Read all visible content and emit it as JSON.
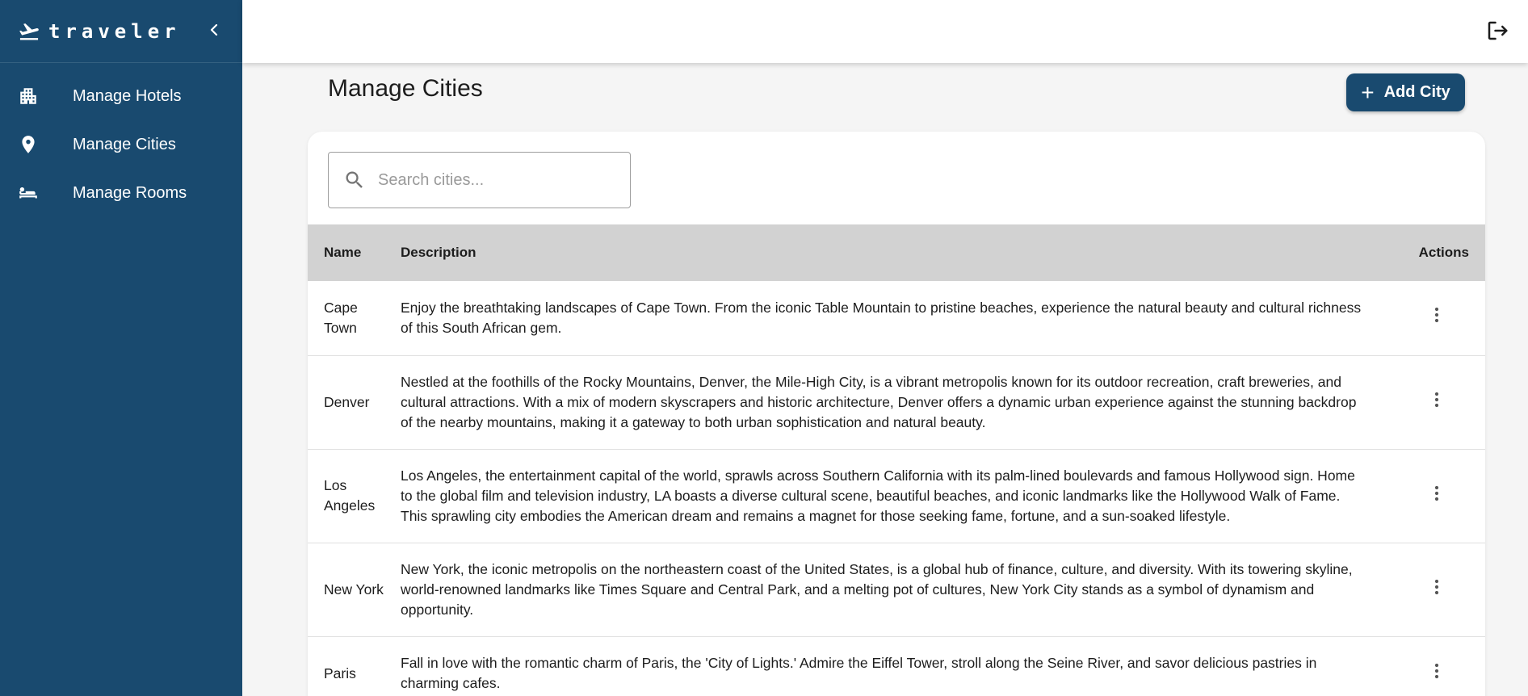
{
  "app": {
    "brand": "traveler"
  },
  "sidebar": {
    "items": [
      {
        "label": "Manage Hotels",
        "icon": "building-icon"
      },
      {
        "label": "Manage Cities",
        "icon": "location-pin-icon"
      },
      {
        "label": "Manage Rooms",
        "icon": "bed-icon"
      }
    ]
  },
  "header": {
    "logout_icon": "logout-icon"
  },
  "main": {
    "title": "Manage Cities",
    "add_button": "Add City",
    "search": {
      "placeholder": "Search cities...",
      "value": ""
    },
    "table": {
      "columns": [
        "Name",
        "Description",
        "Actions"
      ],
      "rows": [
        {
          "name": "Cape Town",
          "description": "Enjoy the breathtaking landscapes of Cape Town. From the iconic Table Mountain to pristine beaches, experience the natural beauty and cultural richness of this South African gem."
        },
        {
          "name": "Denver",
          "description": "Nestled at the foothills of the Rocky Mountains, Denver, the Mile-High City, is a vibrant metropolis known for its outdoor recreation, craft breweries, and cultural attractions. With a mix of modern skyscrapers and historic architecture, Denver offers a dynamic urban experience against the stunning backdrop of the nearby mountains, making it a gateway to both urban sophistication and natural beauty."
        },
        {
          "name": "Los Angeles",
          "description": "Los Angeles, the entertainment capital of the world, sprawls across Southern California with its palm-lined boulevards and famous Hollywood sign. Home to the global film and television industry, LA boasts a diverse cultural scene, beautiful beaches, and iconic landmarks like the Hollywood Walk of Fame. This sprawling city embodies the American dream and remains a magnet for those seeking fame, fortune, and a sun-soaked lifestyle."
        },
        {
          "name": "New York",
          "description": "New York, the iconic metropolis on the northeastern coast of the United States, is a global hub of finance, culture, and diversity. With its towering skyline, world-renowned landmarks like Times Square and Central Park, and a melting pot of cultures, New York City stands as a symbol of dynamism and opportunity."
        },
        {
          "name": "Paris",
          "description": "Fall in love with the romantic charm of Paris, the 'City of Lights.' Admire the Eiffel Tower, stroll along the Seine River, and savor delicious pastries in charming cafes."
        }
      ]
    }
  },
  "colors": {
    "sidebar": "#194a6f",
    "accent": "#194a6f",
    "table_header": "#d2d2d2"
  }
}
